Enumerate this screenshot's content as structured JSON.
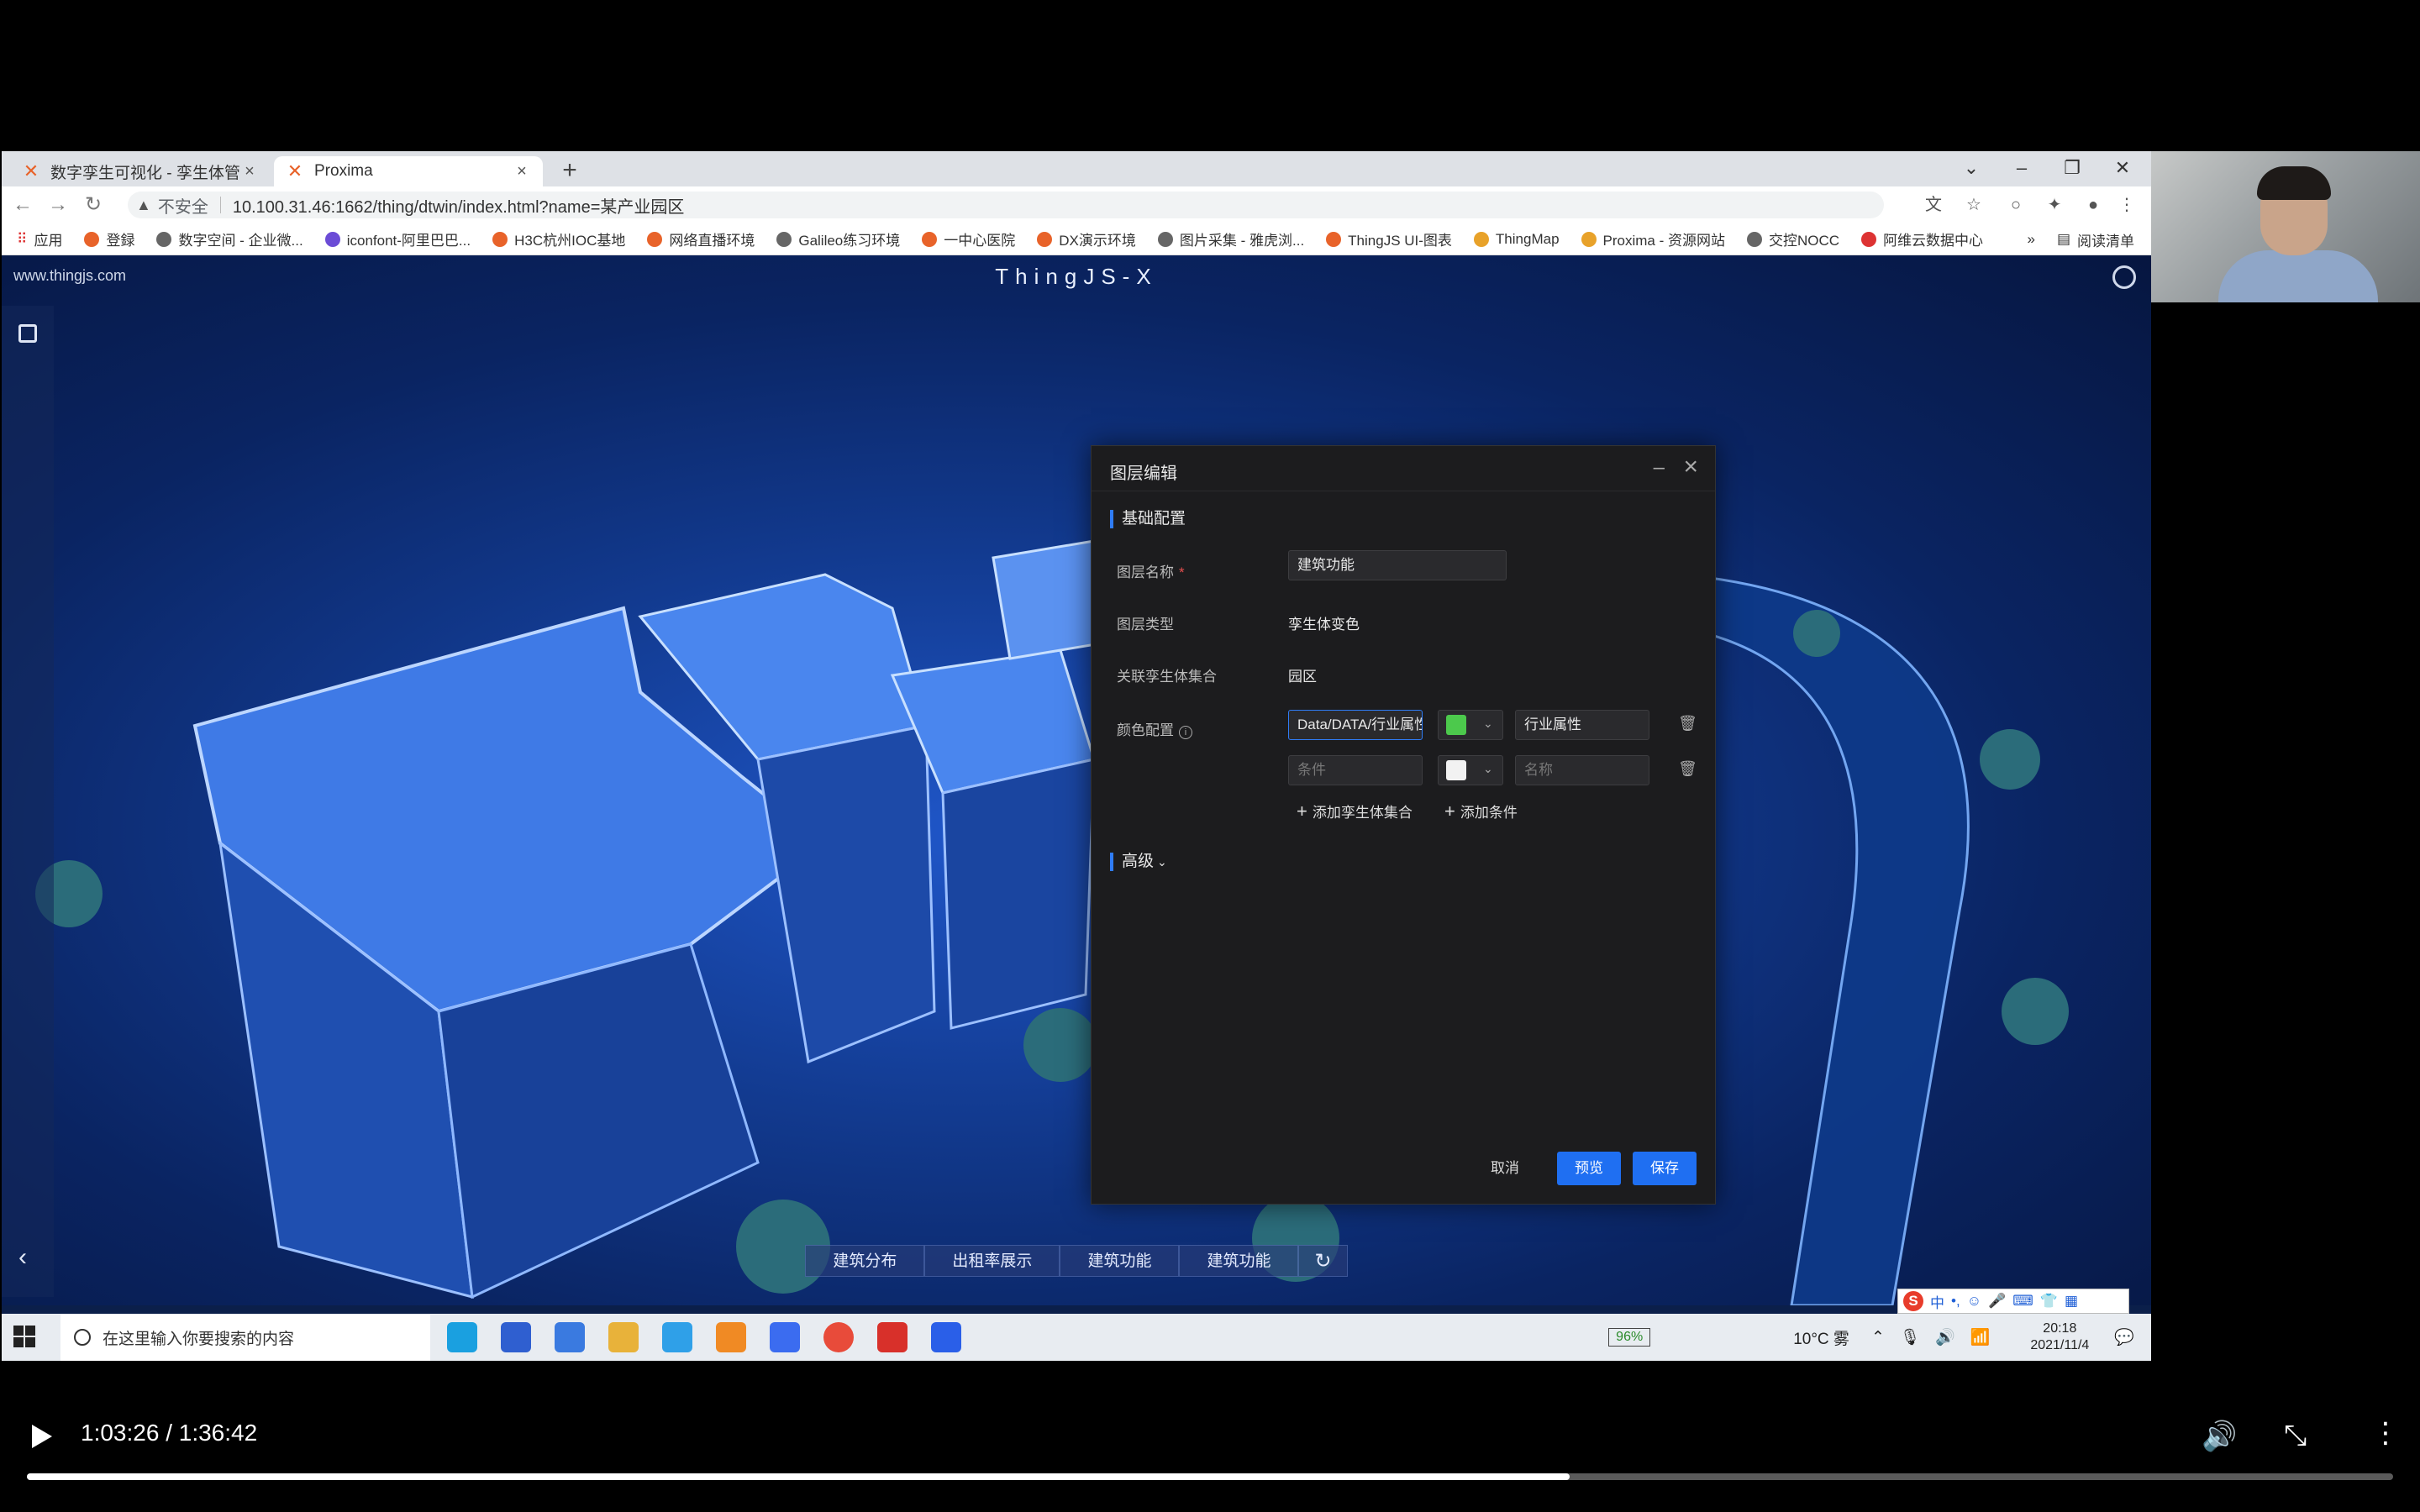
{
  "browser": {
    "tabs": [
      {
        "label": "数字孪生可视化 - 孪生体管理"
      },
      {
        "label": "Proxima"
      }
    ],
    "url": "10.100.31.46:1662/thing/dtwin/index.html?name=某产业园区",
    "security_label": "不安全",
    "bookmarks": [
      "应用",
      "登録",
      "数字空间 - 企业微...",
      "iconfont-阿里巴巴...",
      "H3C杭州IOC基地",
      "网络直播环境",
      "Galileo练习环境",
      "一中心医院",
      "DX演示环境",
      "图片采集 - 雅虎浏...",
      "ThingJS UI-图表",
      "ThingMap",
      "Proxima - 资源网站",
      "交控NOCC",
      "阿维云数据中心"
    ],
    "reading_list": "阅读清单"
  },
  "app": {
    "site_url": "www.thingjs.com",
    "title": "ThingJS-X",
    "bottom_tabs": [
      "建筑分布",
      "出租率展示",
      "建筑功能",
      "建筑功能"
    ]
  },
  "modal": {
    "title": "图层编辑",
    "section_basic": "基础配置",
    "layer_name_label": "图层名称",
    "layer_name_value": "建筑功能",
    "layer_type_label": "图层类型",
    "layer_type_value": "孪生体变色",
    "twin_set_label": "关联孪生体集合",
    "twin_set_value": "园区",
    "color_config_label": "颜色配置",
    "rule1_condition": "Data/DATA/行业属性",
    "rule1_color": "#4cc94c",
    "rule1_name": "行业属性",
    "rule2_condition_placeholder": "条件",
    "rule2_color": "#f2f2f2",
    "rule2_name_placeholder": "名称",
    "add_twin_set": "添加孪生体集合",
    "add_condition": "添加条件",
    "section_advanced": "高级",
    "cancel": "取消",
    "preview": "预览",
    "save": "保存"
  },
  "taskbar": {
    "search_placeholder": "在这里输入你要搜索的内容",
    "battery": "96%",
    "weather": "10°C 雾",
    "time": "20:18",
    "date": "2021/11/4"
  },
  "player": {
    "time": "1:03:26 / 1:36:42",
    "progress": 0.652
  }
}
